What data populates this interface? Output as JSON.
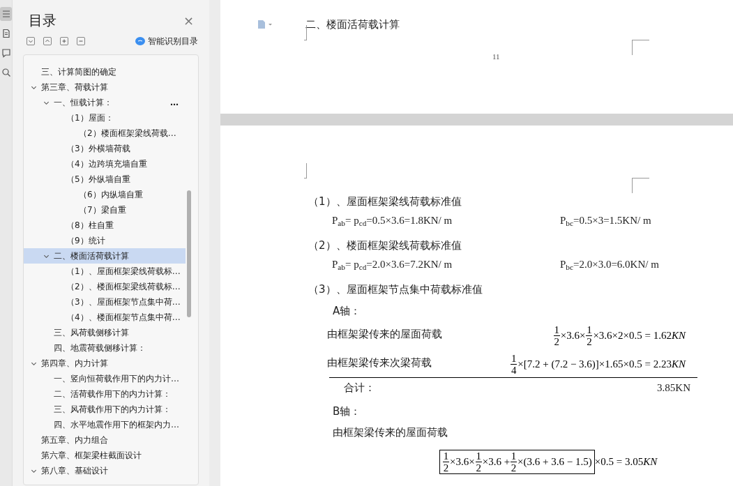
{
  "side_tabs": [
    {
      "kind": "list",
      "selected": true
    },
    {
      "kind": "page",
      "selected": false
    },
    {
      "kind": "comment",
      "selected": false
    },
    {
      "kind": "search",
      "selected": false
    }
  ],
  "toc": {
    "title": "目录",
    "close": "×",
    "tools": [
      {
        "kind": "down"
      },
      {
        "kind": "up"
      },
      {
        "kind": "plus"
      },
      {
        "kind": "minus"
      }
    ],
    "smart_button": "智能识别目录",
    "items": [
      {
        "text": "三、计算简图的确定",
        "selected": false
      },
      {
        "text": "第三章、荷载计算",
        "selected": false,
        "expanded": true,
        "children": [
          {
            "text": "一、恒载计算：",
            "trailing": "…",
            "selected": false,
            "expanded": true,
            "children": [
              {
                "text": "（1）屋面：",
                "selected": false,
                "children": [
                  {
                    "text": "（2）楼面框架梁线荷载…",
                    "selected": false
                  }
                ]
              },
              {
                "text": "（3）外横墙荷载",
                "selected": false
              },
              {
                "text": "（4）边跨填充墙自重",
                "selected": false
              },
              {
                "text": "（5）外纵墙自重",
                "selected": false,
                "children": [
                  {
                    "text": "（6）内纵墙自重",
                    "selected": false
                  },
                  {
                    "text": "（7）梁自重",
                    "selected": false
                  }
                ]
              },
              {
                "text": "（8）柱自重",
                "selected": false
              },
              {
                "text": "（9）统计",
                "selected": false
              }
            ]
          },
          {
            "text": "二、楼面活荷载计算",
            "selected": true,
            "expanded": true,
            "children": [
              {
                "text": "（1）、屋面框架梁线荷载标…",
                "selected": false
              },
              {
                "text": "（2）、楼面框架梁线荷载标…",
                "selected": false
              },
              {
                "text": "（3）、屋面框架节点集中荷…",
                "selected": false
              },
              {
                "text": "（4）、楼面框架节点集中荷…",
                "selected": false
              }
            ]
          },
          {
            "text": "三、风荷载侧移计算",
            "selected": false
          },
          {
            "text": "四、地震荷载侧移计算：",
            "selected": false
          }
        ]
      },
      {
        "text": "第四章、内力计算",
        "selected": false,
        "expanded": true,
        "children": [
          {
            "text": "一、竖向恒荷载作用下的内力计…",
            "selected": false
          },
          {
            "text": "二、活荷载作用下的内力计算：",
            "selected": false
          },
          {
            "text": "三、风荷载作用下的内力计算：",
            "selected": false
          },
          {
            "text": "四、水平地震作用下的框架内力…",
            "selected": false
          }
        ]
      },
      {
        "text": "第五章、内力组合",
        "selected": false
      },
      {
        "text": "第六章、框架梁柱截面设计",
        "selected": false
      },
      {
        "text": "第八章、基础设计",
        "selected": false,
        "expanded": true
      }
    ]
  },
  "page_a": {
    "heading": "二、楼面活荷载计算",
    "page_number": "11"
  },
  "page_b": [
    {
      "kind": "heading",
      "text": "（1）、屋面框架梁线荷载标准值"
    },
    {
      "kind": "pair",
      "left": "P$_{ab}$= p$_{cd}$=0.5×3.6=1.8KN/ m",
      "right": "P$_{bc}$=0.5×3=1.5KN/ m"
    },
    {
      "kind": "heading",
      "text": "（2）、楼面框架梁线荷载标准值"
    },
    {
      "kind": "pair",
      "left": "P$_{ab}$= p$_{cd}$=2.0×3.6=7.2KN/ m",
      "right": "P$_{bc}$=2.0×3.0=6.0KN/ m"
    },
    {
      "kind": "heading",
      "text": "（3）、屋面框架节点集中荷载标准值"
    },
    {
      "kind": "axis",
      "text": "A轴："
    },
    {
      "kind": "load",
      "label": "由框架梁传来的屋面荷载",
      "formula": [
        {
          "kind": "frac",
          "num": "1",
          "den": "2"
        },
        {
          "kind": "text",
          "text": "×3.6×"
        },
        {
          "kind": "frac",
          "num": "1",
          "den": "2"
        },
        {
          "kind": "text",
          "text": "×3.6×2×0.5 = 1.62"
        },
        {
          "kind": "unit",
          "text": "KN"
        }
      ]
    },
    {
      "kind": "load",
      "label": "由框架梁传来次梁荷载",
      "formula": [
        {
          "kind": "frac",
          "num": "1",
          "den": "4"
        },
        {
          "kind": "text",
          "text": "×[7.2 + (7.2 − 3.6)]×1.65×0.5 = 2.23"
        },
        {
          "kind": "unit",
          "text": "KN"
        }
      ]
    },
    {
      "kind": "total",
      "label": "合计：",
      "value": "3.85KN"
    },
    {
      "kind": "axis",
      "text": "B轴："
    },
    {
      "kind": "label",
      "text": "由框架梁传来的屋面荷载"
    },
    {
      "kind": "formula",
      "bracketed": [
        {
          "kind": "frac",
          "num": "1",
          "den": "2"
        },
        {
          "kind": "text",
          "text": "×3.6×"
        },
        {
          "kind": "frac",
          "num": "1",
          "den": "2"
        },
        {
          "kind": "text",
          "text": "×3.6 + "
        },
        {
          "kind": "frac",
          "num": "1",
          "den": "2"
        },
        {
          "kind": "text",
          "text": "×(3.6 + 3.6 − 1.5)"
        }
      ],
      "after": [
        {
          "kind": "text",
          "text": "×0.5 = 3.05"
        },
        {
          "kind": "unit",
          "text": "KN"
        }
      ]
    }
  ]
}
